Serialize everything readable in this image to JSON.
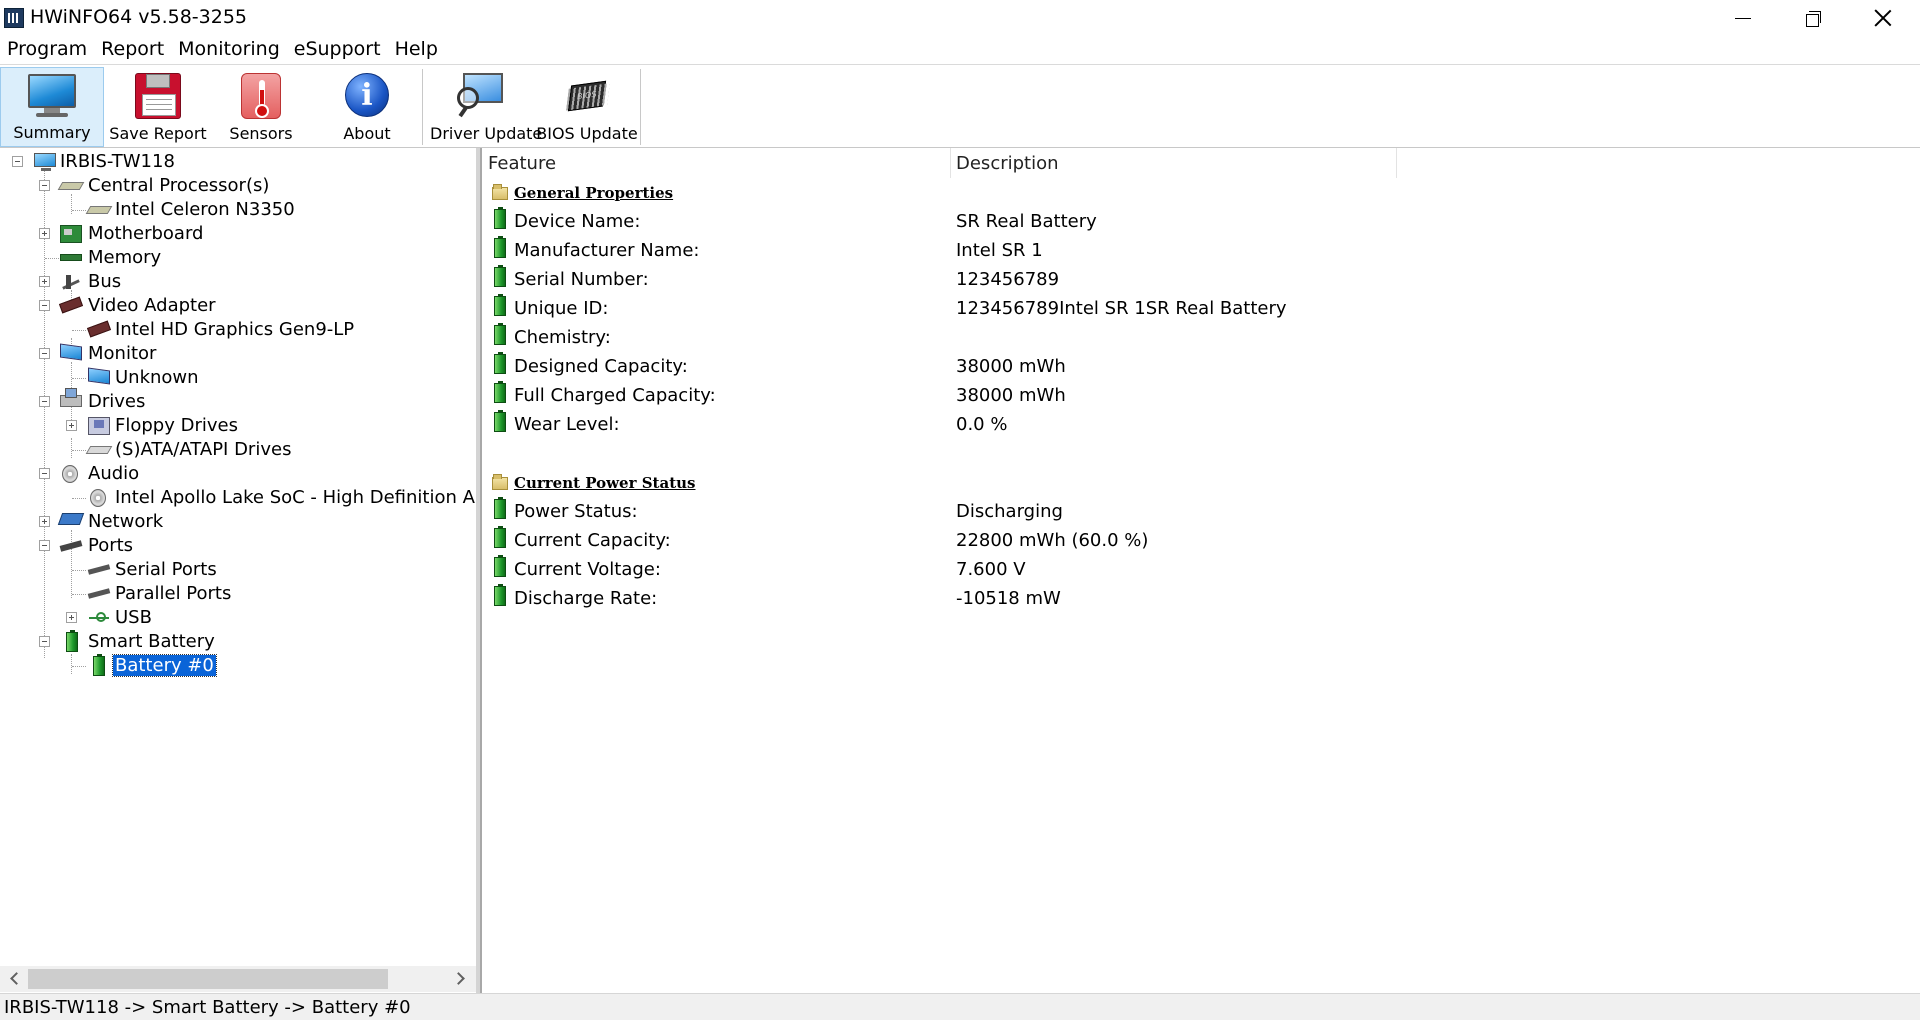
{
  "window": {
    "title": "HWiNFO64 v5.58-3255"
  },
  "menu": [
    "Program",
    "Report",
    "Monitoring",
    "eSupport",
    "Help"
  ],
  "toolbar": {
    "summary": "Summary",
    "save_report": "Save Report",
    "sensors": "Sensors",
    "about": "About",
    "driver_update": "Driver Update",
    "bios_update": "BIOS Update"
  },
  "tree": {
    "root": "IRBIS-TW118",
    "central_processors": "Central Processor(s)",
    "cpu": "Intel Celeron N3350",
    "motherboard": "Motherboard",
    "memory": "Memory",
    "bus": "Bus",
    "video_adapter": "Video Adapter",
    "gpu": "Intel HD Graphics Gen9-LP",
    "monitor": "Monitor",
    "monitor_unknown": "Unknown",
    "drives": "Drives",
    "floppy_drives": "Floppy Drives",
    "sata_drives": "(S)ATA/ATAPI Drives",
    "audio": "Audio",
    "audio_device": "Intel Apollo Lake SoC - High Definition Audio",
    "network": "Network",
    "ports": "Ports",
    "serial_ports": "Serial Ports",
    "parallel_ports": "Parallel Ports",
    "usb": "USB",
    "smart_battery": "Smart Battery",
    "battery0": "Battery #0"
  },
  "details": {
    "col_feature": "Feature",
    "col_description": "Description",
    "general_header": "General Properties",
    "general": [
      {
        "feature": "Device Name:",
        "value": "SR Real Battery"
      },
      {
        "feature": "Manufacturer Name:",
        "value": "Intel SR 1"
      },
      {
        "feature": "Serial Number:",
        "value": "123456789"
      },
      {
        "feature": "Unique ID:",
        "value": "123456789Intel SR 1SR Real Battery"
      },
      {
        "feature": "Chemistry:",
        "value": ""
      },
      {
        "feature": "Designed Capacity:",
        "value": "38000 mWh"
      },
      {
        "feature": "Full Charged Capacity:",
        "value": "38000 mWh"
      },
      {
        "feature": "Wear Level:",
        "value": "0.0 %"
      }
    ],
    "power_header": "Current Power Status",
    "power": [
      {
        "feature": "Power Status:",
        "value": "Discharging"
      },
      {
        "feature": "Current Capacity:",
        "value": "22800 mWh (60.0 %)"
      },
      {
        "feature": "Current Voltage:",
        "value": "7.600 V"
      },
      {
        "feature": "Discharge Rate:",
        "value": "-10518 mW"
      }
    ]
  },
  "status_bar": "IRBIS-TW118 -> Smart Battery -> Battery #0"
}
